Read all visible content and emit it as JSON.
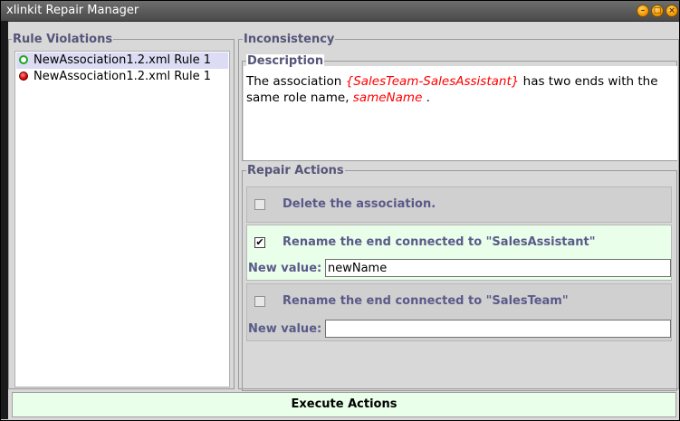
{
  "window": {
    "title": "xlinkit Repair Manager"
  },
  "rule_violations": {
    "label": "Rule Violations",
    "items": [
      {
        "label": "NewAssociation1.2.xml Rule 1",
        "status_color": "#1ea51e",
        "selected": true
      },
      {
        "label": "NewAssociation1.2.xml Rule 1",
        "status_color": "#e00000",
        "selected": false
      }
    ]
  },
  "inconsistency": {
    "label": "Inconsistency",
    "description": {
      "label": "Description",
      "text_1": "The association ",
      "highlight_1": "{SalesTeam-SalesAssistant}",
      "text_2": " has two ends with the same role name, ",
      "highlight_2": "sameName",
      "text_3": " ."
    }
  },
  "repair_actions": {
    "label": "Repair Actions",
    "actions": [
      {
        "label": "Delete the association.",
        "checked": false
      },
      {
        "label": "Rename the end connected to \"SalesAssistant\"",
        "checked": true,
        "new_value_label": "New value:",
        "new_value": "newName"
      },
      {
        "label": "Rename the end connected to \"SalesTeam\"",
        "checked": false,
        "new_value_label": "New value:",
        "new_value": ""
      }
    ]
  },
  "execute_button": {
    "label": "Execute Actions"
  },
  "colors": {
    "accent_label": "#55557a",
    "highlight_text": "#ff0000",
    "active_panel": "#eaffea",
    "inactive_panel": "#d0d0d0"
  }
}
